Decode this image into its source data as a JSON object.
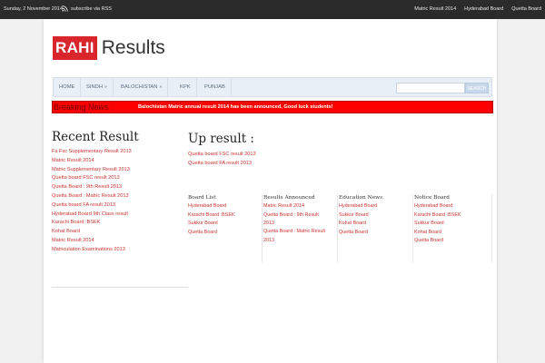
{
  "topbar": {
    "date": "Sunday, 2 November 2014",
    "rss_label": "subscribe via RSS",
    "rss_icon": "rss-icon",
    "links": [
      "Matric Result 2014",
      "Hyderabad Board",
      "Quetta Board"
    ]
  },
  "logo": {
    "brand": "RAHI",
    "suffix": "Results",
    "brand_color": "#d8262c"
  },
  "nav": {
    "items": [
      {
        "label": "HOME",
        "dropdown": false
      },
      {
        "label": "SINDH",
        "dropdown": true
      },
      {
        "label": "BALOCHISTAN",
        "dropdown": true
      },
      {
        "label": "KPK",
        "dropdown": false
      },
      {
        "label": "PUNJAB",
        "dropdown": false
      }
    ],
    "search_placeholder": "",
    "search_button": "SEARCH"
  },
  "breaking": {
    "label": "Breaking News :",
    "message": "Balochistan Matric annual result 2014 has been announced, Good luck students!",
    "color": "#ff0000"
  },
  "recent": {
    "title": "Recent Result",
    "items": [
      "Fa Fsc Supplementary Result 2013",
      "Matric Result 2014",
      "Matric Supplementary Result 2013",
      "Quetta board FSC result 2013",
      "Quetta Board : 9th Result 2013",
      "Quetta Board : Matric Result 2013",
      "Quetta board FA result 2013",
      "Hyderabad Board 9th Class result",
      "Karachi Board :BSEK",
      "Kohat Board",
      "Matric Result 2014",
      "Matriculation Examinations 2013"
    ]
  },
  "up": {
    "title": "Up result :",
    "items": [
      "Quetta board FSC result 2013",
      "Quetta board FA result 2013"
    ]
  },
  "boards": [
    {
      "title": "Board List",
      "items": [
        "Hyderabad Board",
        "Karachi Board :BSEK",
        "Sukkur Board",
        "Quetta Board"
      ]
    },
    {
      "title": "Results Announced",
      "items": [
        "Matric Result 2014",
        "Quetta Board : 9th Result 2013",
        "Quetta Board : Matric Result 2013"
      ]
    },
    {
      "title": "Education News",
      "items": [
        "Hyderabad Board",
        "Sukkur Board",
        "Kohat Board",
        "Quetta Board"
      ]
    },
    {
      "title": "Notice Board",
      "items": [
        "Hyderabad Board",
        "Karachi Board :BSEK",
        "Sukkur Board",
        "Kohat Board",
        "Quetta Board"
      ]
    }
  ]
}
